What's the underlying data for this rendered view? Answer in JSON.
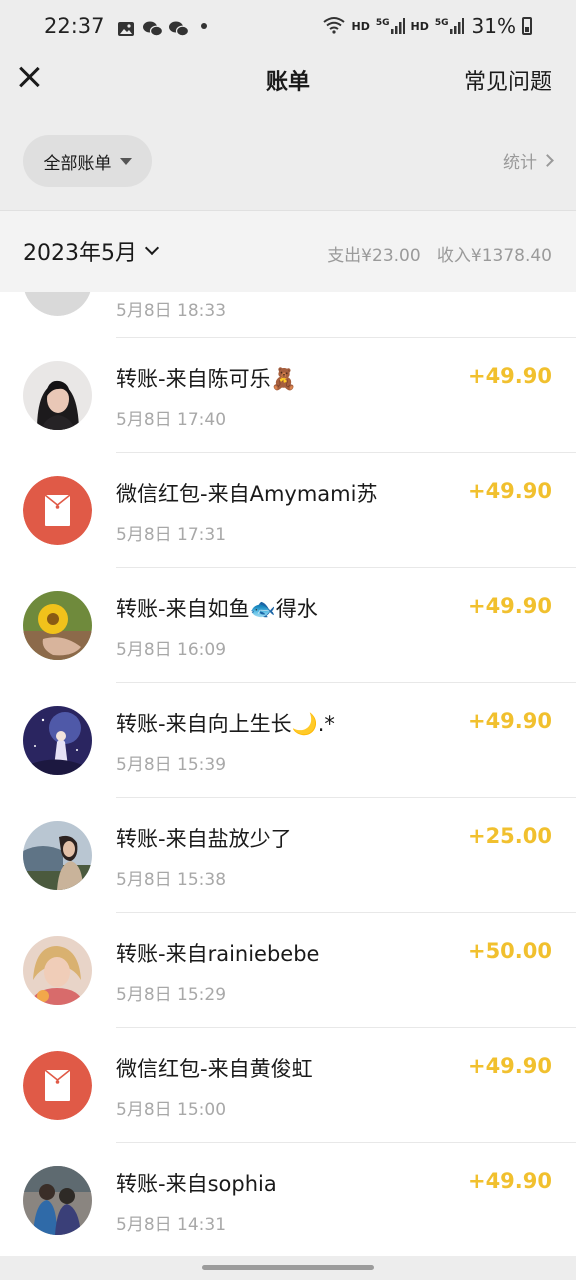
{
  "status_bar": {
    "time": "22:37",
    "icons": [
      "image-icon",
      "wechat-icon",
      "wechat-icon",
      "dot-icon"
    ],
    "right_icons": [
      "wifi-icon",
      "hd-5g-signal-icon",
      "hd-5g-signal-icon",
      "battery-icon"
    ],
    "hd_label": "HD",
    "network_label": "5G",
    "battery_percent": "31%"
  },
  "nav": {
    "title": "账单",
    "faq_label": "常见问题",
    "close_icon": "close-icon"
  },
  "filter": {
    "all_bills_label": "全部账单",
    "stats_label": "统计"
  },
  "month": {
    "label": "2023年5月",
    "summary": "支出¥23.00   收入¥1378.40"
  },
  "partial_item": {
    "time": "5月8日 18:33"
  },
  "transactions": [
    {
      "title": "转账-来自陈可乐🧸",
      "time": "5月8日 17:40",
      "amount": "+49.90",
      "avatar": "photo-avatar-woman"
    },
    {
      "title": "微信红包-来自Amymami苏",
      "time": "5月8日 17:31",
      "amount": "+49.90",
      "avatar": "red-packet-icon"
    },
    {
      "title": "转账-来自如鱼🐟得水",
      "time": "5月8日 16:09",
      "amount": "+49.90",
      "avatar": "photo-avatar-sunflower"
    },
    {
      "title": "转账-来自向上生长🌙.*",
      "time": "5月8日 15:39",
      "amount": "+49.90",
      "avatar": "photo-avatar-night-sky"
    },
    {
      "title": "转账-来自盐放少了",
      "time": "5月8日 15:38",
      "amount": "+25.00",
      "avatar": "photo-avatar-girl-outdoor"
    },
    {
      "title": "转账-来自rainiebebe",
      "time": "5月8日 15:29",
      "amount": "+50.00",
      "avatar": "photo-avatar-blonde"
    },
    {
      "title": "微信红包-来自黄俊虹",
      "time": "5月8日 15:00",
      "amount": "+49.90",
      "avatar": "red-packet-icon"
    },
    {
      "title": "转账-来自sophia",
      "time": "5月8日 14:31",
      "amount": "+49.90",
      "avatar": "photo-avatar-couple"
    }
  ],
  "colors": {
    "amount": "#f1c02e",
    "red_packet": "#e05a47",
    "background": "#ededed"
  }
}
